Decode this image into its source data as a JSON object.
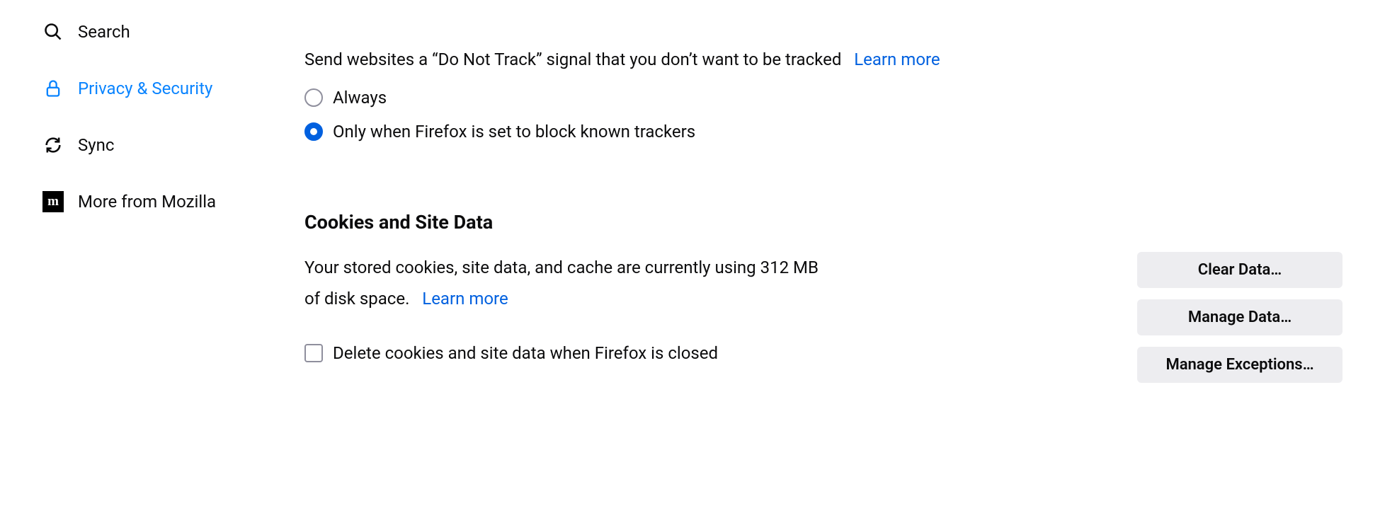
{
  "sidebar": {
    "items": [
      {
        "label": "Search",
        "icon": "search"
      },
      {
        "label": "Privacy & Security",
        "icon": "lock",
        "active": true
      },
      {
        "label": "Sync",
        "icon": "sync"
      },
      {
        "label": "More from Mozilla",
        "icon": "mozilla"
      }
    ]
  },
  "dnt": {
    "description": "Send websites a “Do Not Track” signal that you don’t want to be tracked",
    "learn_more": "Learn more",
    "options": {
      "always": "Always",
      "only_when": "Only when Firefox is set to block known trackers"
    },
    "selected": "only_when"
  },
  "cookies": {
    "heading": "Cookies and Site Data",
    "description_part1": "Your stored cookies, site data, and cache are currently using 312 MB of disk space.",
    "learn_more": "Learn more",
    "delete_on_close": "Delete cookies and site data when Firefox is closed",
    "buttons": {
      "clear_data": "Clear Data…",
      "manage_data": "Manage Data…",
      "manage_exceptions": "Manage Exceptions…"
    }
  }
}
